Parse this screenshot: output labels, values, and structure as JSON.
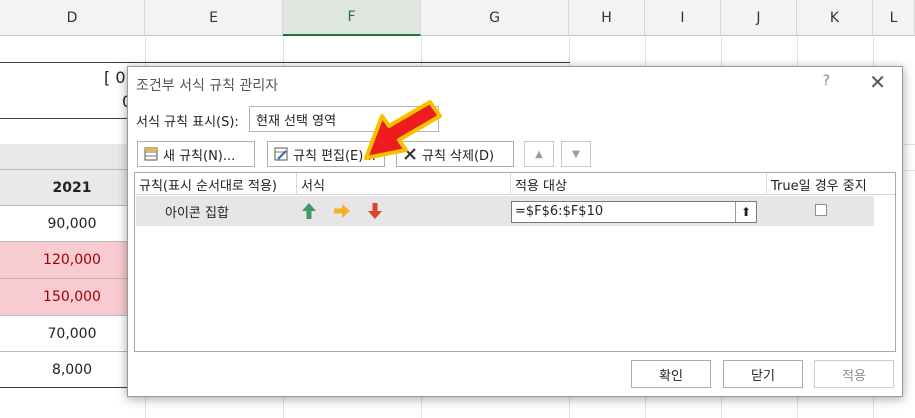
{
  "spreadsheet": {
    "columns": [
      "D",
      "E",
      "F",
      "G",
      "H",
      "I",
      "J",
      "K",
      "L"
    ],
    "partial_text_1": "[ 0",
    "partial_text_2": "0",
    "year_header": "2021",
    "values": [
      "90,000",
      "120,000",
      "150,000",
      "70,000",
      "8,000"
    ],
    "highlight_color": "#f8cbd1",
    "highlight_text_color": "#9c0006"
  },
  "dialog": {
    "title": "조건부 서식 규칙 관리자",
    "help": "?",
    "close": "✕",
    "show_rules_label": "서식 규칙 표시(S):",
    "show_rules_value": "현재 선택 영역",
    "new_rule": "새 규칙(N)...",
    "edit_rule": "규칙 편집(E)...",
    "delete_rule": "규칙 삭제(D)",
    "headers": {
      "rule": "규칙(표시 순서대로 적용)",
      "format": "서식",
      "applies_to": "적용 대상",
      "stop_if_true": "True일 경우 중지"
    },
    "rules": [
      {
        "name": "아이콘 집합",
        "applies_to": "=$F$6:$F$10",
        "stop_if_true": false
      }
    ],
    "ok": "확인",
    "close_button": "닫기",
    "apply": "적용"
  },
  "icons": {
    "up": "green-up-arrow-icon",
    "right": "yellow-right-arrow-icon",
    "down": "red-down-arrow-icon",
    "pointer": "red-pointer-arrow"
  },
  "colors": {
    "accent_green": "#217346",
    "pointer_red": "#ee1c1c",
    "pointer_yellow": "#f7c200"
  }
}
